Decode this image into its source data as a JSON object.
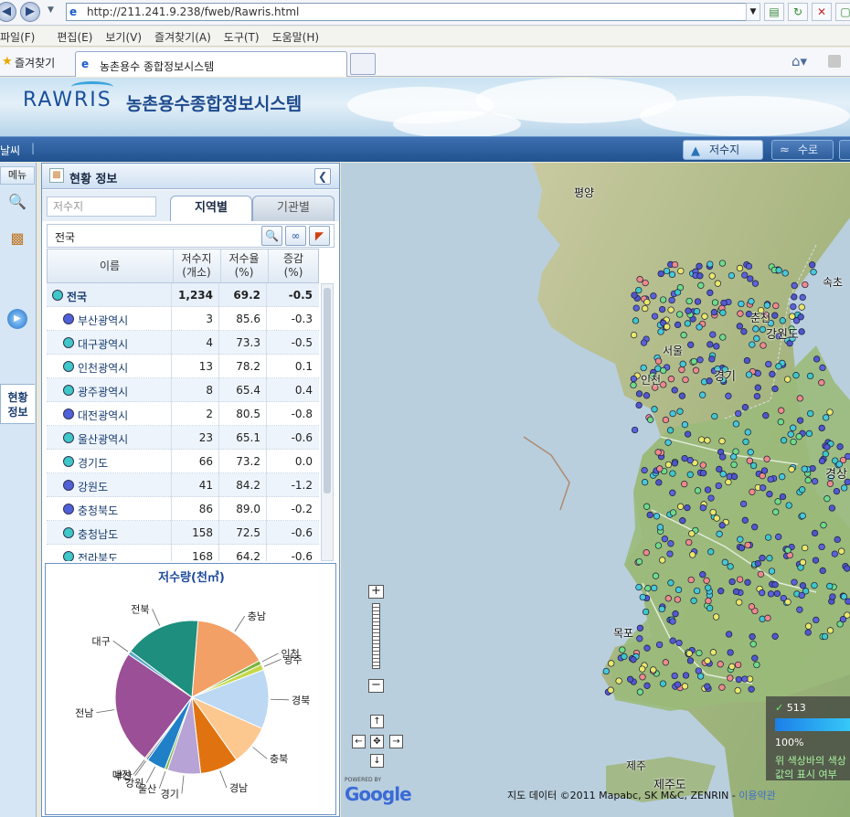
{
  "browser": {
    "url": "http://211.241.9.238/fweb/Rawris.html",
    "menu": [
      "파일(F)",
      "편집(E)",
      "보기(V)",
      "즐겨찾기(A)",
      "도구(T)",
      "도움말(H)"
    ],
    "favorites_label": "즐겨찾기",
    "tab_title": "농촌용수 종합정보시스템"
  },
  "site": {
    "logo": "RAWRIS",
    "title": "농촌용수종합정보시스템",
    "weather": "날씨",
    "nav_tabs": [
      "저수지",
      "수로"
    ]
  },
  "left_menu": {
    "header": "메뉴",
    "active_item": [
      "현황",
      "정보"
    ]
  },
  "panel": {
    "title": "현황 정보",
    "search_placeholder": "저수지",
    "tabs": [
      "지역별",
      "기관별"
    ],
    "region_value": "전국",
    "columns": [
      "이름",
      "저수지\n(개소)",
      "저수율\n(%)",
      "증감\n(%)"
    ],
    "rows": [
      {
        "name": "전국",
        "count": "1,234",
        "rate": "69.2",
        "change": "-0.5",
        "color": "#3ec8c8",
        "level": 0
      },
      {
        "name": "부산광역시",
        "count": "3",
        "rate": "85.6",
        "change": "-0.3",
        "color": "#5060d8",
        "level": 1
      },
      {
        "name": "대구광역시",
        "count": "4",
        "rate": "73.3",
        "change": "-0.5",
        "color": "#3ec8c8",
        "level": 1
      },
      {
        "name": "인천광역시",
        "count": "13",
        "rate": "78.2",
        "change": "0.1",
        "color": "#3ec8c8",
        "level": 1
      },
      {
        "name": "광주광역시",
        "count": "8",
        "rate": "65.4",
        "change": "0.4",
        "color": "#3ec8c8",
        "level": 1
      },
      {
        "name": "대전광역시",
        "count": "2",
        "rate": "80.5",
        "change": "-0.8",
        "color": "#5060d8",
        "level": 1
      },
      {
        "name": "울산광역시",
        "count": "23",
        "rate": "65.1",
        "change": "-0.6",
        "color": "#3ec8c8",
        "level": 1
      },
      {
        "name": "경기도",
        "count": "66",
        "rate": "73.2",
        "change": "0.0",
        "color": "#3ec8c8",
        "level": 1
      },
      {
        "name": "강원도",
        "count": "41",
        "rate": "84.2",
        "change": "-1.2",
        "color": "#5060d8",
        "level": 1
      },
      {
        "name": "충청북도",
        "count": "86",
        "rate": "89.0",
        "change": "-0.2",
        "color": "#5060d8",
        "level": 1
      },
      {
        "name": "충청남도",
        "count": "158",
        "rate": "72.5",
        "change": "-0.6",
        "color": "#3ec8c8",
        "level": 1
      },
      {
        "name": "전라북도",
        "count": "168",
        "rate": "64.2",
        "change": "-0.6",
        "color": "#3ec8c8",
        "level": 1
      }
    ]
  },
  "chart_data": {
    "type": "pie",
    "title": "저수량(천㎥)",
    "slices": [
      {
        "label": "충남",
        "value": 15.8,
        "color": "#f2a066"
      },
      {
        "label": "인천",
        "value": 0.9,
        "color": "#7ab540"
      },
      {
        "label": "광주",
        "value": 1.2,
        "color": "#c6d84a"
      },
      {
        "label": "경북",
        "value": 12.5,
        "color": "#bcd8f2"
      },
      {
        "label": "충북",
        "value": 8.5,
        "color": "#fcc890"
      },
      {
        "label": "경남",
        "value": 8.0,
        "color": "#e0730f"
      },
      {
        "label": "경기",
        "value": 7.0,
        "color": "#b7a3d5"
      },
      {
        "label": "울산",
        "value": 0.6,
        "color": "#84b84a"
      },
      {
        "label": "강원",
        "value": 4.0,
        "color": "#1f80c8"
      },
      {
        "label": "부산",
        "value": 0.4,
        "color": "#2f5ca0"
      },
      {
        "label": "대전",
        "value": 0.3,
        "color": "#c47a2a"
      },
      {
        "label": "전남",
        "value": 24.0,
        "color": "#9a4f96"
      },
      {
        "label": "대구",
        "value": 0.8,
        "color": "#58a8c8"
      },
      {
        "label": "전북",
        "value": 16.0,
        "color": "#1e8e7e"
      }
    ]
  },
  "map": {
    "cities": [
      "평양",
      "속초",
      "춘천",
      "강원도",
      "서울",
      "인천",
      "경기",
      "경상",
      "목포",
      "제주",
      "제주도"
    ],
    "copyright": "지도 데이터 ©2011 Mapabc, SK M&C, ZENRIN -",
    "terms_link": "이용약관",
    "google_powered": "POWERED BY",
    "google": "Google",
    "legend": {
      "count": "513",
      "percent": "100%",
      "desc1": "위 색상바의 색상",
      "desc2": "값의 표시 여부"
    }
  }
}
